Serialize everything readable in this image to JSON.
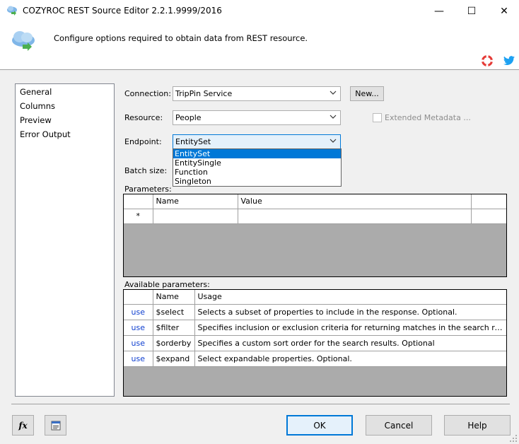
{
  "window": {
    "title": "COZYROC REST Source Editor 2.2.1.9999/2016",
    "minimize_glyph": "—",
    "maximize_glyph": "☐",
    "close_glyph": "✕"
  },
  "header": {
    "description": "Configure options required to obtain data from REST resource."
  },
  "nav": {
    "items": [
      {
        "label": "General"
      },
      {
        "label": "Columns"
      },
      {
        "label": "Preview"
      },
      {
        "label": "Error Output"
      }
    ]
  },
  "form": {
    "connection_label": "Connection:",
    "connection_value": "TripPin Service",
    "new_button": "New...",
    "resource_label": "Resource:",
    "resource_value": "People",
    "extended_metadata_label": "Extended Metadata ...",
    "endpoint_label": "Endpoint:",
    "endpoint_value": "EntitySet",
    "endpoint_options": [
      "EntitySet",
      "EntitySingle",
      "Function",
      "Singleton"
    ],
    "batch_size_label": "Batch size:"
  },
  "parameters": {
    "caption": "Parameters:",
    "columns": [
      "Name",
      "Value"
    ],
    "new_row_marker": "*"
  },
  "available": {
    "caption": "Available parameters:",
    "columns": [
      "Name",
      "Usage"
    ],
    "rows": [
      {
        "action": "use",
        "name": "$select",
        "usage": "Selects a subset of properties to include in the response. Optional."
      },
      {
        "action": "use",
        "name": "$filter",
        "usage": "Specifies inclusion or exclusion criteria for returning matches in the search results. Optio..."
      },
      {
        "action": "use",
        "name": "$orderby",
        "usage": "Specifies a custom sort order for the search results. Optional"
      },
      {
        "action": "use",
        "name": "$expand",
        "usage": "Select expandable properties. Optional."
      }
    ]
  },
  "footer": {
    "fx_label": "fx",
    "ok": "OK",
    "cancel": "Cancel",
    "help": "Help"
  },
  "colors": {
    "accent": "#0078d7",
    "link": "#1040d0",
    "grid_empty": "#ababab"
  }
}
